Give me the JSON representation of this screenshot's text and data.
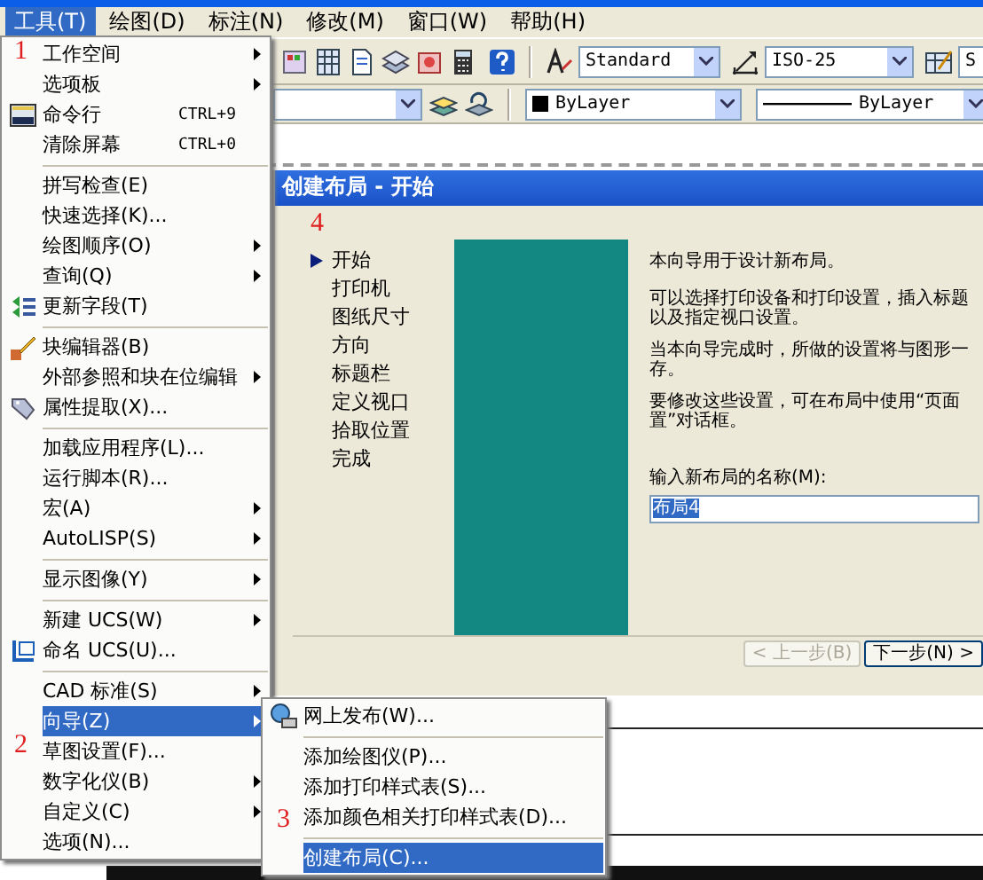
{
  "menu_bar": [
    {
      "label": "工具(T)",
      "selected": true
    },
    {
      "label": "绘图(D)",
      "selected": false
    },
    {
      "label": "标注(N)",
      "selected": false
    },
    {
      "label": "修改(M)",
      "selected": false
    },
    {
      "label": "窗口(W)",
      "selected": false
    },
    {
      "label": "帮助(H)",
      "selected": false
    }
  ],
  "toolbar": {
    "text_style": "Standard",
    "dim_style": "ISO-25",
    "table_style": "S",
    "color_dropdown": "ByLayer",
    "linetype": "ByLayer"
  },
  "tools_menu": {
    "groups": [
      [
        {
          "label": "工作空间",
          "submenu": true,
          "selected": false
        },
        {
          "label": "选项板",
          "submenu": true,
          "selected": false
        },
        {
          "label": "命令行",
          "shortcut": "CTRL+9",
          "submenu": false,
          "selected": false
        },
        {
          "label": "清除屏幕",
          "shortcut": "CTRL+0",
          "submenu": false,
          "selected": false
        }
      ],
      [
        {
          "label": "拼写检查(E)",
          "submenu": false,
          "selected": false
        },
        {
          "label": "快速选择(K)...",
          "submenu": false,
          "selected": false
        },
        {
          "label": "绘图顺序(O)",
          "submenu": true,
          "selected": false
        },
        {
          "label": "查询(Q)",
          "submenu": true,
          "selected": false
        },
        {
          "label": "更新字段(T)",
          "submenu": false,
          "selected": false
        }
      ],
      [
        {
          "label": "块编辑器(B)",
          "submenu": false,
          "selected": false
        },
        {
          "label": "外部参照和块在位编辑",
          "submenu": true,
          "selected": false
        },
        {
          "label": "属性提取(X)...",
          "submenu": false,
          "selected": false
        }
      ],
      [
        {
          "label": "加载应用程序(L)...",
          "submenu": false,
          "selected": false
        },
        {
          "label": "运行脚本(R)...",
          "submenu": false,
          "selected": false
        },
        {
          "label": "宏(A)",
          "submenu": true,
          "selected": false
        },
        {
          "label": "AutoLISP(S)",
          "submenu": true,
          "selected": false
        }
      ],
      [
        {
          "label": "显示图像(Y)",
          "submenu": true,
          "selected": false
        }
      ],
      [
        {
          "label": "新建 UCS(W)",
          "submenu": true,
          "selected": false
        },
        {
          "label": "命名 UCS(U)...",
          "submenu": false,
          "selected": false
        }
      ],
      [
        {
          "label": "CAD 标准(S)",
          "submenu": true,
          "selected": false
        },
        {
          "label": "向导(Z)",
          "submenu": true,
          "selected": true
        },
        {
          "label": "草图设置(F)...",
          "submenu": false,
          "selected": false
        },
        {
          "label": "数字化仪(B)",
          "submenu": true,
          "selected": false
        },
        {
          "label": "自定义(C)",
          "submenu": true,
          "selected": false
        },
        {
          "label": "选项(N)...",
          "submenu": false,
          "selected": false
        }
      ]
    ]
  },
  "wizard_submenu": {
    "groups": [
      [
        {
          "label": "网上发布(W)...",
          "selected": false
        }
      ],
      [
        {
          "label": "添加绘图仪(P)...",
          "selected": false
        },
        {
          "label": "添加打印样式表(S)...",
          "selected": false
        },
        {
          "label": "添加颜色相关打印样式表(D)...",
          "selected": false
        }
      ],
      [
        {
          "label": "创建布局(C)...",
          "selected": true
        }
      ]
    ]
  },
  "dialog": {
    "title": "创建布局 - 开始",
    "steps": [
      {
        "label": "开始",
        "selected": true
      },
      {
        "label": "打印机",
        "selected": false
      },
      {
        "label": "图纸尺寸",
        "selected": false
      },
      {
        "label": "方向",
        "selected": false
      },
      {
        "label": "标题栏",
        "selected": false
      },
      {
        "label": "定义视口",
        "selected": false
      },
      {
        "label": "拾取位置",
        "selected": false
      },
      {
        "label": "完成",
        "selected": false
      }
    ],
    "paragraphs": [
      [
        "本向导用于设计新布局。"
      ],
      [
        "可以选择打印设备和打印设置，插入标题",
        "以及指定视口设置。"
      ],
      [
        "当本向导完成时，所做的设置将与图形一",
        "存。"
      ],
      [
        "要修改这些设置，可在布局中使用“页面",
        "置”对话框。"
      ]
    ],
    "name_label": "输入新布局的名称(M):",
    "name_value": "布局4",
    "buttons": [
      {
        "label": "< 上一步(B)",
        "disabled": true
      },
      {
        "label": "下一步(N) >",
        "disabled": false
      }
    ]
  },
  "annotations": [
    {
      "label": "1"
    },
    {
      "label": "2"
    },
    {
      "label": "3"
    },
    {
      "label": "4"
    }
  ]
}
